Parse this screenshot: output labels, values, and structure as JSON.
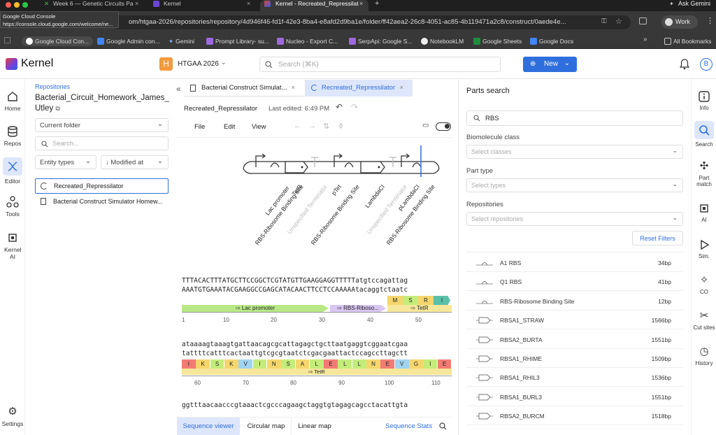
{
  "browser": {
    "tabs": [
      {
        "title": "Week 6 — Genetic Circuits Pa",
        "active": false
      },
      {
        "title": "Kernel",
        "active": false
      },
      {
        "title": "Kernel - Recreated_Repressilat",
        "active": true
      }
    ],
    "ask_gemini": "Ask Gemini",
    "tooltip_title": "Google Cloud Console",
    "tooltip_url": "https://console.cloud.google.com/welcome/ne...",
    "url": "om/htgaa-2026/repositories/repository/4d946f46-fd1f-42e3-8ba4-e8afd2d9ba1e/folder/ff42aea2-26c8-4051-ac85-4b119471a2c8/construct/0aede4e...",
    "profile": "Work",
    "bookmarks": [
      "Google Cloud Con...",
      "Google Admin con...",
      "Gemini",
      "Prompt Library- su...",
      "Nucleo - Export C...",
      "SerpApi: Google S...",
      "NotebookLM",
      "Google Sheets",
      "Google Docs"
    ],
    "all_bookmarks": "All Bookmarks"
  },
  "app": {
    "brand": "Kernel",
    "workspace_initial": "H",
    "workspace_name": "HTGAA 2026",
    "search_placeholder": "Search (⌘K)",
    "new_label": "New",
    "user_initial": "B"
  },
  "left_nav": [
    "Home",
    "Repos",
    "Editor",
    "Tools",
    "Kernel AI",
    "Settings"
  ],
  "folder_panel": {
    "breadcrumb": "Repositories",
    "title": "Bacterial_Circuit_Homework_James_Utley",
    "scope": "Current folder",
    "search_placeholder": "Search...",
    "filter_types": "Entity types",
    "sort": "Modified at",
    "items": [
      "Recreated_Repressilator",
      "Bacterial Construct Simulator Homew..."
    ]
  },
  "editor": {
    "tabs": [
      "Bacterial Construct Simulat...",
      "Recreated_Repressilator"
    ],
    "doc_name": "Recreated_Repressilator",
    "last_edited": "Last edited: 6:49 PM",
    "menu": [
      "File",
      "Edit",
      "View"
    ],
    "map_labels": [
      "Lac promoter",
      "RBS-Ribosome Binding Site",
      "TetR",
      "Unspecified Terminator",
      "pTet",
      "RBS-Ribosome Binding Site",
      "LambdaCI",
      "Unspecified Terminator",
      "pLambdaCI",
      "RBS-Ribosome Binding Site"
    ],
    "seq_block1": {
      "top": "TTTACACTTTATGCTTCCGGCTCGTATGTTGAAGGAGGTTTTTatgtccagattag",
      "bottom": "AAATGTGAAATACGAAGGCCGAGCATACAACTTCCTCCAAAAAtacaggtctaatc",
      "aa": [
        "M",
        "S",
        "R",
        "I"
      ],
      "features": [
        "Lac promoter",
        "RBS-Riboso...",
        "TetR"
      ],
      "ruler": [
        "1",
        "10",
        "20",
        "30",
        "40",
        "50"
      ]
    },
    "seq_block2": {
      "top": "ataaaagtaaagtgattaacagcgcattagagctgcttaatgaggtcggaatcgaa",
      "bottom": "tattttcatttcactaattgtcgcgtaatctcgacgaattactccagccttagctt",
      "aa": [
        "I",
        "K",
        "S",
        "K",
        "V",
        "I",
        "N",
        "S",
        "A",
        "L",
        "E",
        "L",
        "L",
        "N",
        "E",
        "V",
        "G",
        "I",
        "E"
      ],
      "feature": "TetR",
      "ruler": [
        "60",
        "70",
        "80",
        "90",
        "100",
        "110"
      ]
    },
    "seq_block3_top": "ggtttaacaacccgtaaactcgcccagaagctaggtgtagagcagcctacattgta",
    "bottom_tabs": [
      "Sequence viewer",
      "Circular map",
      "Linear map"
    ],
    "sequence_stats": "Sequence Stats"
  },
  "parts_search": {
    "title": "Parts search",
    "query": "RBS",
    "biomolecule_label": "Biomolecule class",
    "biomolecule_placeholder": "Select classes",
    "part_type_label": "Part type",
    "part_type_placeholder": "Select types",
    "repos_label": "Repositories",
    "repos_placeholder": "Select repositories",
    "reset": "Reset Filters",
    "results": [
      {
        "name": "A1 RBS",
        "size": "34bp"
      },
      {
        "name": "Q1 RBS",
        "size": "41bp"
      },
      {
        "name": "RBS-Ribosome Binding Site",
        "size": "12bp"
      },
      {
        "name": "RBSA1_STRAW",
        "size": "1566bp"
      },
      {
        "name": "RBSA2_BURTA",
        "size": "1551bp"
      },
      {
        "name": "RBSA1_RHIME",
        "size": "1509bp"
      },
      {
        "name": "RBSA1_RHIL3",
        "size": "1536bp"
      },
      {
        "name": "RBSA1_BURL3",
        "size": "1551bp"
      },
      {
        "name": "RBSA2_BURCM",
        "size": "1518bp"
      }
    ]
  },
  "right_nav": [
    "Info",
    "Search",
    "Part match",
    "AI",
    "Sim.",
    "CO",
    "Cut sites",
    "History"
  ]
}
